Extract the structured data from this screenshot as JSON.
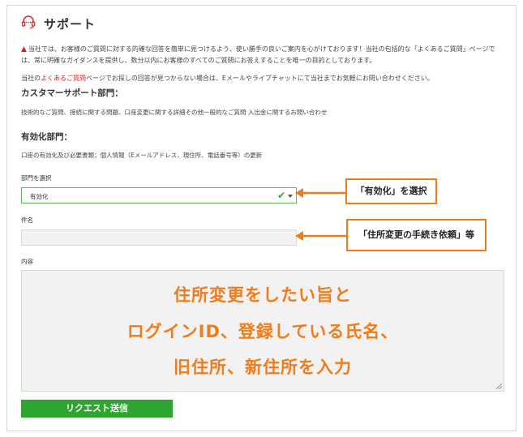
{
  "header": {
    "title": "サポート",
    "icon": "headset-icon"
  },
  "notice": {
    "line1": "当社では、お客様のご質問に対する的確な回答を簡単に見つけるよう、使い勝手の良いご案内を心がけております！当社の包括的な「よくあるご質問」ページでは、常に明確なガイダンスを提供し、数分以内にお客様のすべてのご質問にお答えすることを唯一の目的としております。",
    "line2_pre": "当社の",
    "line2_link": "よくあるご質問",
    "line2_post": "ページでお探しの回答が見つからない場合は、Eメールやライブチャットにて当社までお気軽にお問い合わせください。"
  },
  "sections": {
    "customer": {
      "title": "カスタマーサポート部門：",
      "desc": "技術的なご質問、接続に関する問題、口座変更に関する詳細その他一般的なご質問 入出金に関するお問い合わせ"
    },
    "activation": {
      "title": "有効化部門：",
      "desc": "口座の有効化及び必要書類；個人情報（Eメールアドレス、現住所、電話番号等）の更新"
    }
  },
  "form": {
    "dept_label": "部門を選択",
    "dept_value": "有効化",
    "subject_label": "件名",
    "subject_value": "",
    "content_label": "内容",
    "content_value": "",
    "submit_label": "リクエスト送信"
  },
  "annotations": {
    "callout1": "「有効化」を選択",
    "callout2": "「住所変更の手続き依頼」等",
    "overlay_line1": "住所変更をしたい旨と",
    "overlay_line2": "ログインID、登録している氏名、",
    "overlay_line3": "旧住所、新住所を入力"
  },
  "colors": {
    "accent_red": "#d32020",
    "success_green": "#2ea52e",
    "annotation_orange": "#f07c1a"
  }
}
